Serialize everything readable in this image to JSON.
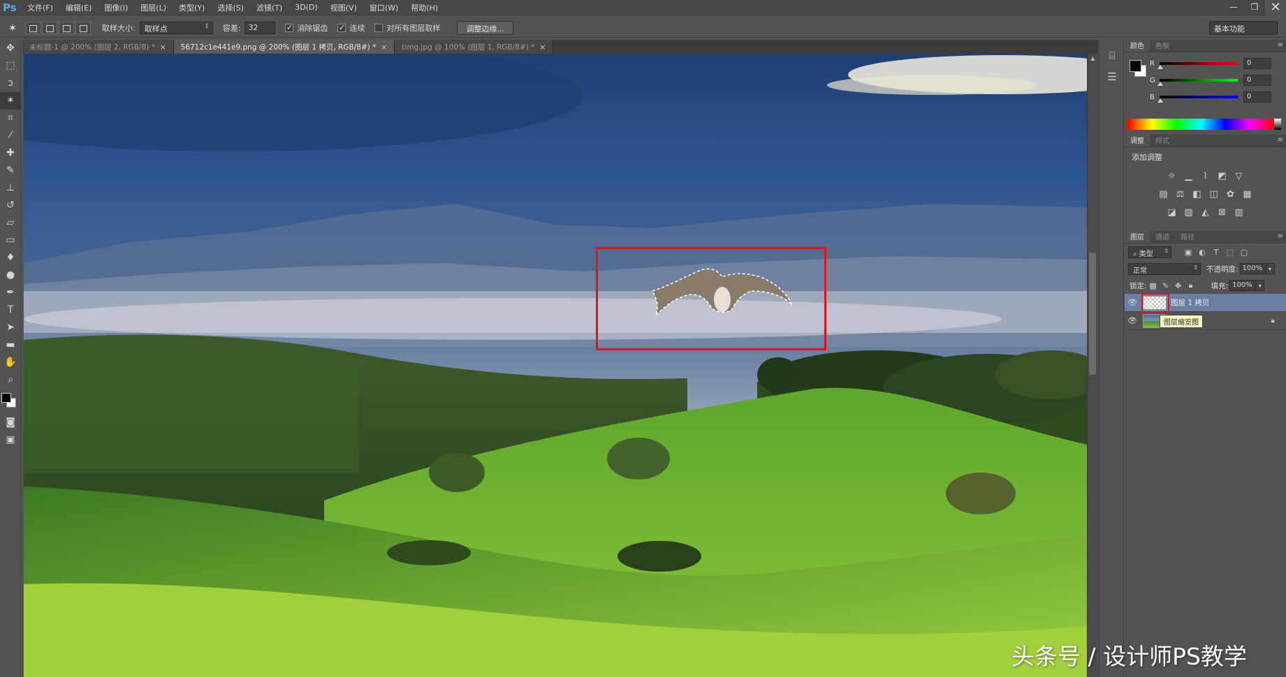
{
  "menubar": {
    "logo": "Ps",
    "items": [
      "文件(F)",
      "编辑(E)",
      "图像(I)",
      "图层(L)",
      "类型(Y)",
      "选择(S)",
      "滤镜(T)",
      "3D(D)",
      "视图(V)",
      "窗口(W)",
      "帮助(H)"
    ],
    "window_controls": {
      "minimize": "—",
      "restore": "❐",
      "close": "✕"
    }
  },
  "options_bar": {
    "tool_icon": "magic-wand",
    "sample_size_label": "取样大小:",
    "sample_size_value": "取样点",
    "tolerance_label": "容差:",
    "tolerance_value": "32",
    "antialias_label": "消除锯齿",
    "antialias_checked": true,
    "contiguous_label": "连续",
    "contiguous_checked": true,
    "sample_all_layers_label": "对所有图层取样",
    "sample_all_layers_checked": false,
    "refine_edge_button": "调整边缘...",
    "workspace": "基本功能"
  },
  "document_tabs": [
    {
      "title": "未标题-1 @ 200% (图层 2, RGB/8) *",
      "active": false,
      "close": "×"
    },
    {
      "title": "56712c1e441e9.png @ 200% (图层 1 拷贝, RGB/8#) *",
      "active": true,
      "close": "×"
    },
    {
      "title": "timg.jpg @ 100% (图层 1, RGB/8#) *",
      "active": false,
      "close": "×"
    }
  ],
  "toolbox": [
    "move-tool",
    "marquee-tool",
    "lasso-tool",
    "magic-wand-tool",
    "crop-tool",
    "eyedropper-tool",
    "healing-brush-tool",
    "brush-tool",
    "clone-stamp-tool",
    "history-brush-tool",
    "eraser-tool",
    "gradient-tool",
    "blur-tool",
    "dodge-tool",
    "pen-tool",
    "type-tool",
    "path-selection-tool",
    "rectangle-tool",
    "hand-tool",
    "zoom-tool"
  ],
  "color_panel": {
    "tabs": [
      "颜色",
      "色板"
    ],
    "foreground": "#000000",
    "background": "#ffffff",
    "channels": [
      {
        "label": "R",
        "value": "0",
        "gradient": "linear-gradient(to right, #000, #ff0000)"
      },
      {
        "label": "G",
        "value": "0",
        "gradient": "linear-gradient(to right, #000, #00ff00)"
      },
      {
        "label": "B",
        "value": "0",
        "gradient": "linear-gradient(to right, #000, #0000ff)"
      }
    ]
  },
  "adjustments_panel": {
    "tabs": [
      "调整",
      "样式"
    ],
    "title": "添加调整"
  },
  "layers_panel": {
    "tabs": [
      "图层",
      "通道",
      "路径"
    ],
    "filter_kind": "类型",
    "blend_mode": "正常",
    "opacity_label": "不透明度:",
    "opacity_value": "100%",
    "lock_label": "锁定:",
    "fill_label": "填充:",
    "fill_value": "100%",
    "layers": [
      {
        "name": "图层 1 拷贝",
        "selected": true,
        "visible": true
      },
      {
        "name": "",
        "selected": false,
        "visible": true,
        "locked": true
      }
    ],
    "tooltip": "图层缩览图"
  },
  "watermark": "头条号 / 设计师PS教学",
  "colors": {
    "selection_highlight": "#e0151a",
    "accent": "#5aa8f0"
  }
}
